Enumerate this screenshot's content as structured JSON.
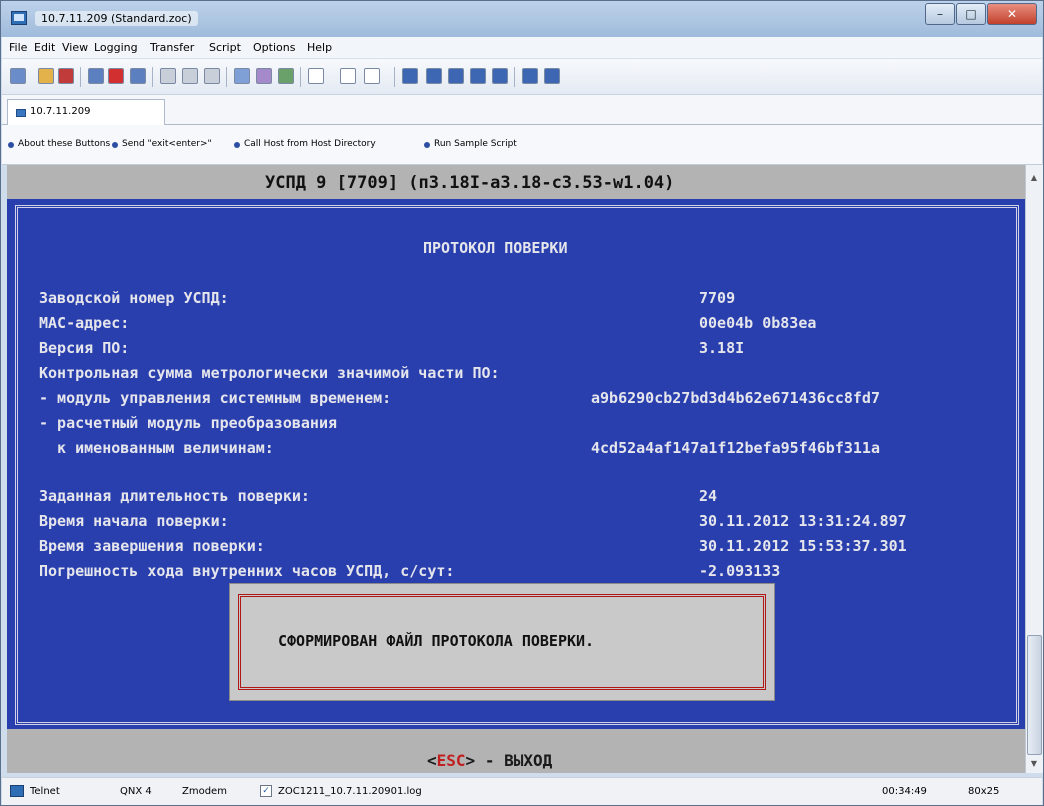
{
  "window": {
    "title": "10.7.11.209 (Standard.zoc)",
    "controls": {
      "minimize": "–",
      "maximize": "□",
      "close": "✕"
    }
  },
  "menu": [
    "File",
    "Edit",
    "View",
    "Logging",
    "Transfer",
    "Script",
    "Options",
    "Help"
  ],
  "session_tab": {
    "label": "10.7.11.209"
  },
  "user_buttons": [
    "About these Buttons",
    "Send \"exit<enter>\"",
    "Call Host from Host Directory",
    "Run Sample Script"
  ],
  "terminal": {
    "header": "УСПД 9 [7709]  (п3.18I-а3.18-с3.53-w1.04)",
    "heading": "ПРОТОКОЛ ПОВЕРКИ",
    "lines": [
      {
        "label": "Заводской номер УСПД:",
        "value": "7709"
      },
      {
        "label": "MAC-адрес:",
        "value": "00e04b 0b83ea"
      },
      {
        "label": "Версия ПО:",
        "value": "3.18I"
      },
      {
        "label": "Контрольная сумма метрологически значимой части ПО:",
        "value": ""
      },
      {
        "label": "- модуль управления системным временем:",
        "value": "a9b6290cb27bd3d4b62e671436cc8fd7"
      },
      {
        "label": "- расчетный модуль преобразования",
        "value": ""
      },
      {
        "label": "  к именованным величинам:",
        "value": "4cd52a4af147a1f12befa95f46bf311a"
      },
      {
        "label": "Заданная длительность поверки:",
        "value": "24"
      },
      {
        "label": "Время начала поверки:",
        "value": "30.11.2012 13:31:24.897"
      },
      {
        "label": "Время завершения поверки:",
        "value": "30.11.2012 15:53:37.301"
      },
      {
        "label": "Погрешность хода внутренних часов УСПД, с/сут:",
        "value": "-2.093133"
      }
    ],
    "dialog_message": "СФОРМИРОВАН ФАЙЛ ПРОТОКОЛА ПОВЕРКИ.",
    "footer": {
      "open": "<",
      "key": "ESC",
      "close": ">",
      "action": " - ВЫХОД"
    }
  },
  "statusbar": {
    "emulation": "Telnet",
    "terminal_type": "QNX 4",
    "transfer": "Zmodem",
    "log_file": "ZOC1211_10.7.11.20901.log",
    "time": "00:34:49",
    "size": "80x25"
  },
  "colors": {
    "terminal_bg": "#2a3fae",
    "terminal_text": "#e5e5ec",
    "header_bg": "#b3b3b3",
    "dialog_border": "#b01818",
    "esc_key": "#c11e1e"
  }
}
